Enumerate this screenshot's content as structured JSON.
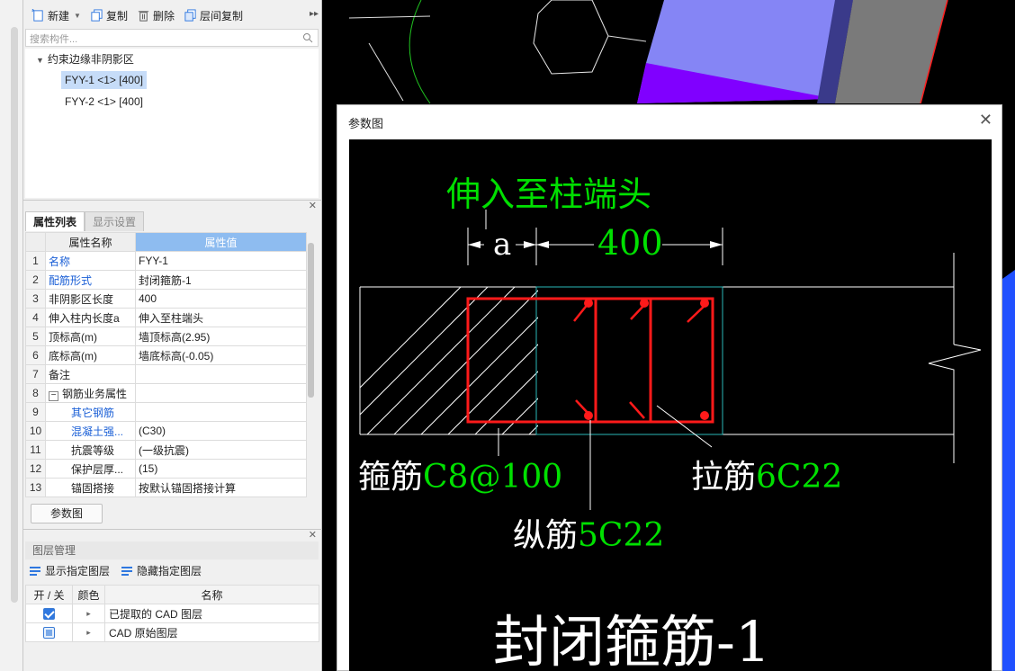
{
  "toolbar": {
    "new_label": "新建",
    "copy_label": "复制",
    "delete_label": "删除",
    "floor_copy_label": "层间复制"
  },
  "search": {
    "placeholder": "搜索构件..."
  },
  "tree": {
    "root_label": "约束边缘非阴影区",
    "items": [
      {
        "label": "FYY-1 <1> [400]",
        "selected": true
      },
      {
        "label": "FYY-2 <1> [400]",
        "selected": false
      }
    ]
  },
  "tabs": {
    "props": "属性列表",
    "display": "显示设置"
  },
  "prop_table": {
    "header_name": "属性名称",
    "header_value": "属性值",
    "rows": [
      {
        "num": "1",
        "name": "名称",
        "value": "FYY-1"
      },
      {
        "num": "2",
        "name": "配筋形式",
        "value": "封闭箍筋-1"
      },
      {
        "num": "3",
        "name": "非阴影区长度",
        "value": "400"
      },
      {
        "num": "4",
        "name": "伸入柱内长度a",
        "value": "伸入至柱端头"
      },
      {
        "num": "5",
        "name": "顶标高(m)",
        "value": "墙顶标高(2.95)"
      },
      {
        "num": "6",
        "name": "底标高(m)",
        "value": "墙底标高(-0.05)"
      },
      {
        "num": "7",
        "name": "备注",
        "value": ""
      },
      {
        "num": "8",
        "name": "钢筋业务属性",
        "value": ""
      },
      {
        "num": "9",
        "name": "其它钢筋",
        "value": ""
      },
      {
        "num": "10",
        "name": "混凝土强...",
        "value": "(C30)"
      },
      {
        "num": "11",
        "name": "抗震等级",
        "value": "(一级抗震)"
      },
      {
        "num": "12",
        "name": "保护层厚...",
        "value": "(15)"
      },
      {
        "num": "13",
        "name": "锚固搭接",
        "value": "按默认锚固搭接计算"
      }
    ]
  },
  "param_button": "参数图",
  "layer_panel": {
    "title": "图层管理",
    "show_label": "显示指定图层",
    "hide_label": "隐藏指定图层",
    "col_toggle": "开 / 关",
    "col_color": "颜色",
    "col_name": "名称",
    "rows": [
      {
        "name": "已提取的 CAD 图层",
        "on": true
      },
      {
        "name": "CAD 原始图层",
        "on": false
      }
    ]
  },
  "dialog": {
    "title": "参数图",
    "diagram": {
      "top_label": "伸入至柱端头",
      "dim_a": "a",
      "dim_length": "400",
      "stirrup_label": "箍筋",
      "stirrup_value": "C8@100",
      "tie_label": "拉筋",
      "tie_value": "6C22",
      "long_label": "纵筋",
      "long_value": "5C22",
      "caption": "封闭箍筋-1"
    }
  },
  "colors": {
    "accent": "#2f78e0",
    "cad_green": "#00e000",
    "cad_red": "#ff1a1a",
    "cad_cyan": "#2ab7b7",
    "header_blue": "#8ebcf0"
  }
}
